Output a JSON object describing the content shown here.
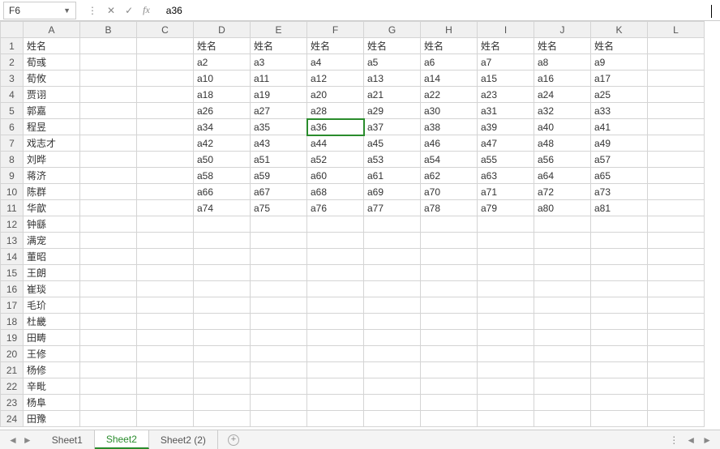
{
  "name_box": {
    "value": "F6",
    "dropdown_glyph": "▼"
  },
  "formula_bar": {
    "cancel_glyph": "✕",
    "accept_glyph": "✓",
    "fx_label": "fx",
    "value": "a36"
  },
  "columns": [
    "A",
    "B",
    "C",
    "D",
    "E",
    "F",
    "G",
    "H",
    "I",
    "J",
    "K",
    "L"
  ],
  "row_count": 24,
  "selected": {
    "row": 6,
    "col": "F"
  },
  "cells": {
    "A1": "姓名",
    "D1": "姓名",
    "E1": "姓名",
    "F1": "姓名",
    "G1": "姓名",
    "H1": "姓名",
    "I1": "姓名",
    "J1": "姓名",
    "K1": "姓名",
    "A2": "荀彧",
    "D2": "a2",
    "E2": "a3",
    "F2": "a4",
    "G2": "a5",
    "H2": "a6",
    "I2": "a7",
    "J2": "a8",
    "K2": "a9",
    "A3": "荀攸",
    "D3": "a10",
    "E3": "a11",
    "F3": "a12",
    "G3": "a13",
    "H3": "a14",
    "I3": "a15",
    "J3": "a16",
    "K3": "a17",
    "A4": "贾诩",
    "D4": "a18",
    "E4": "a19",
    "F4": "a20",
    "G4": "a21",
    "H4": "a22",
    "I4": "a23",
    "J4": "a24",
    "K4": "a25",
    "A5": "郭嘉",
    "D5": "a26",
    "E5": "a27",
    "F5": "a28",
    "G5": "a29",
    "H5": "a30",
    "I5": "a31",
    "J5": "a32",
    "K5": "a33",
    "A6": "程昱",
    "D6": "a34",
    "E6": "a35",
    "F6": "a36",
    "G6": "a37",
    "H6": "a38",
    "I6": "a39",
    "J6": "a40",
    "K6": "a41",
    "A7": "戏志才",
    "D7": "a42",
    "E7": "a43",
    "F7": "a44",
    "G7": "a45",
    "H7": "a46",
    "I7": "a47",
    "J7": "a48",
    "K7": "a49",
    "A8": "刘晔",
    "D8": "a50",
    "E8": "a51",
    "F8": "a52",
    "G8": "a53",
    "H8": "a54",
    "I8": "a55",
    "J8": "a56",
    "K8": "a57",
    "A9": "蒋济",
    "D9": "a58",
    "E9": "a59",
    "F9": "a60",
    "G9": "a61",
    "H9": "a62",
    "I9": "a63",
    "J9": "a64",
    "K9": "a65",
    "A10": "陈群",
    "D10": "a66",
    "E10": "a67",
    "F10": "a68",
    "G10": "a69",
    "H10": "a70",
    "I10": "a71",
    "J10": "a72",
    "K10": "a73",
    "A11": "华歆",
    "D11": "a74",
    "E11": "a75",
    "F11": "a76",
    "G11": "a77",
    "H11": "a78",
    "I11": "a79",
    "J11": "a80",
    "K11": "a81",
    "A12": "钟繇",
    "A13": "满宠",
    "A14": "董昭",
    "A15": "王朗",
    "A16": "崔琰",
    "A17": "毛玠",
    "A18": "杜畿",
    "A19": "田畴",
    "A20": "王修",
    "A21": "杨修",
    "A22": "辛毗",
    "A23": "杨阜",
    "A24": "田豫"
  },
  "sheet_tabs": {
    "nav_prev_glyph": "◄",
    "nav_next_glyph": "►",
    "tabs": [
      {
        "label": "Sheet1",
        "active": false
      },
      {
        "label": "Sheet2",
        "active": true
      },
      {
        "label": "Sheet2 (2)",
        "active": false
      }
    ],
    "add_glyph": "+",
    "hscroll_dots": "⋮",
    "hscroll_left": "◄",
    "hscroll_right": "►"
  }
}
